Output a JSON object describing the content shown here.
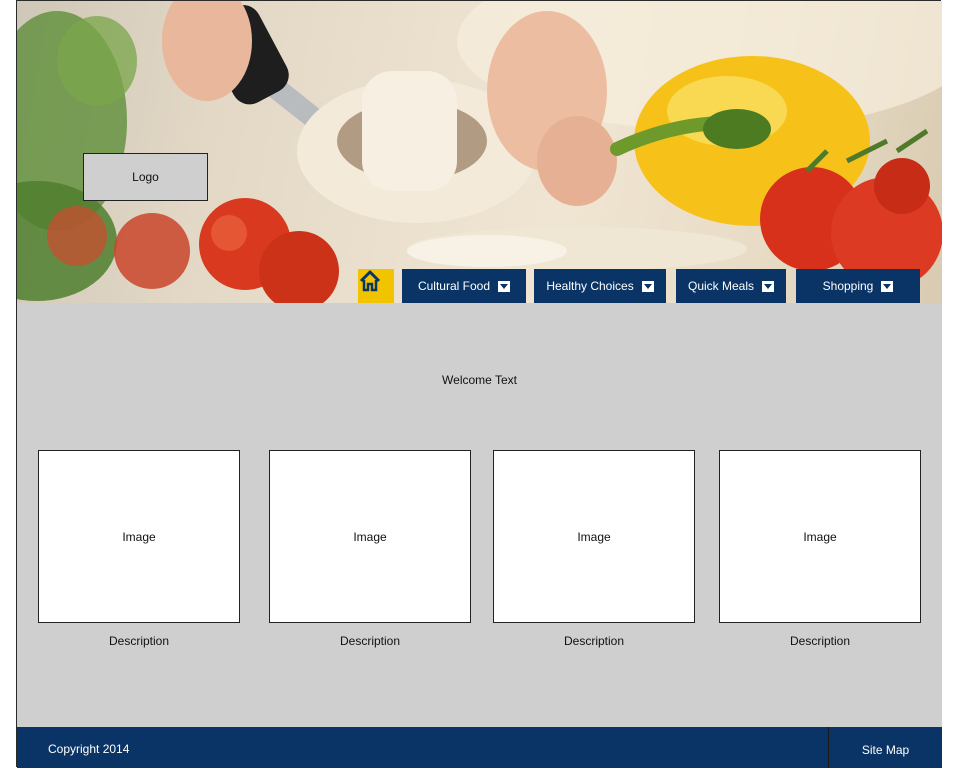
{
  "header": {
    "logo_label": "Logo",
    "hero_image": "cooking-photo"
  },
  "nav": {
    "home_icon": "home-icon",
    "items": [
      {
        "label": "Cultural Food",
        "icon": "dropdown-icon"
      },
      {
        "label": "Healthy Choices",
        "icon": "dropdown-icon"
      },
      {
        "label": "Quick Meals",
        "icon": "dropdown-icon"
      },
      {
        "label": "Shopping",
        "icon": "dropdown-icon"
      }
    ]
  },
  "main": {
    "welcome_text": "Welcome Text",
    "cards": [
      {
        "image_label": "Image",
        "description": "Description"
      },
      {
        "image_label": "Image",
        "description": "Description"
      },
      {
        "image_label": "Image",
        "description": "Description"
      },
      {
        "image_label": "Image",
        "description": "Description"
      }
    ]
  },
  "footer": {
    "copyright": "Copyright 2014",
    "sitemap": "Site Map"
  },
  "colors": {
    "navy": "#0b3466",
    "home_yellow": "#f2c400",
    "content_gray": "#cfcfcf"
  }
}
